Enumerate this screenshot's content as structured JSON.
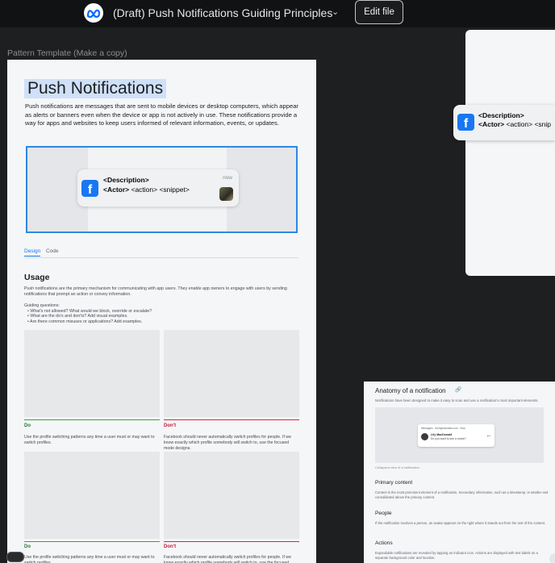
{
  "topbar": {
    "logo_icon": "meta-logo-icon",
    "file_title": "(Draft) Push Notifications Guiding Principles",
    "chevron": "⌄",
    "edit_label": "Edit file"
  },
  "canvas": {
    "frame_label": "Pattern Template (Make a copy)"
  },
  "doc": {
    "title": "Push Notifications",
    "intro": "Push notifications are messages that are sent to mobile devices or desktop computers, which appear as alerts or banners even when the device or app is not actively in use. These notifications provide a way for apps and websites to keep users informed of relevant information, events, or updates.",
    "notification": {
      "app_icon": "facebook-icon",
      "app_glyph": "f",
      "description": "<Description>",
      "actor": "<Actor>",
      "rest": " <action> <snippet>",
      "time": "now"
    },
    "tabs": [
      "Design",
      "Code"
    ],
    "usage": {
      "heading": "Usage",
      "paragraph": "Push notifications are the primary mechanism for communicating with app users. They enable app owners to engage with users by sending notifications that prompt an action or convey information.",
      "guiding_title": "Guiding questions:",
      "questions": [
        "What's not allowed? What would we block, override or escalate?",
        "What are the do's and don'ts? Add visual examples.",
        "Are there common misuses or applications? Add examples."
      ]
    },
    "examples": {
      "do_label": "Do",
      "dont_label": "Don't",
      "do_text": "Use the profile switching patterns any time a user must or may want to switch profiles.",
      "dont_text": "Facebook should never automatically switch profiles for people. If we know exactly which profile somebody will switch to, use the focused mode designs."
    }
  },
  "right_preview": {
    "description": "<Description>",
    "actor": "<Actor>",
    "rest": " <action> <snip"
  },
  "anatomy": {
    "heading": "Anatomy of a notification",
    "link_icon": "link-icon",
    "intro": "Notifications have been designed to make it easy to scan and use a notification's most important elements.",
    "card": {
      "top": "Messages · thenightonwalk.com · Now ·",
      "name": "Lily MacDonald",
      "message": "Do you want to see a movie?",
      "reply_icon": "reply-icon"
    },
    "caption": "Collapsed view of a notification",
    "sections": [
      {
        "title": "Primary content",
        "text": "Content is the most prominent element of a notification. Secondary information, such as a timestamp, is smaller and consolidated above the primary content."
      },
      {
        "title": "People",
        "text": "If the notification involves a person, an avatar appears on the right where it stands out from the rest of the content."
      },
      {
        "title": "Actions",
        "text": "Expandable notifications are revealed by tapping an indicator icon. Actions are displayed with text labels on a separate background color and location."
      }
    ]
  }
}
